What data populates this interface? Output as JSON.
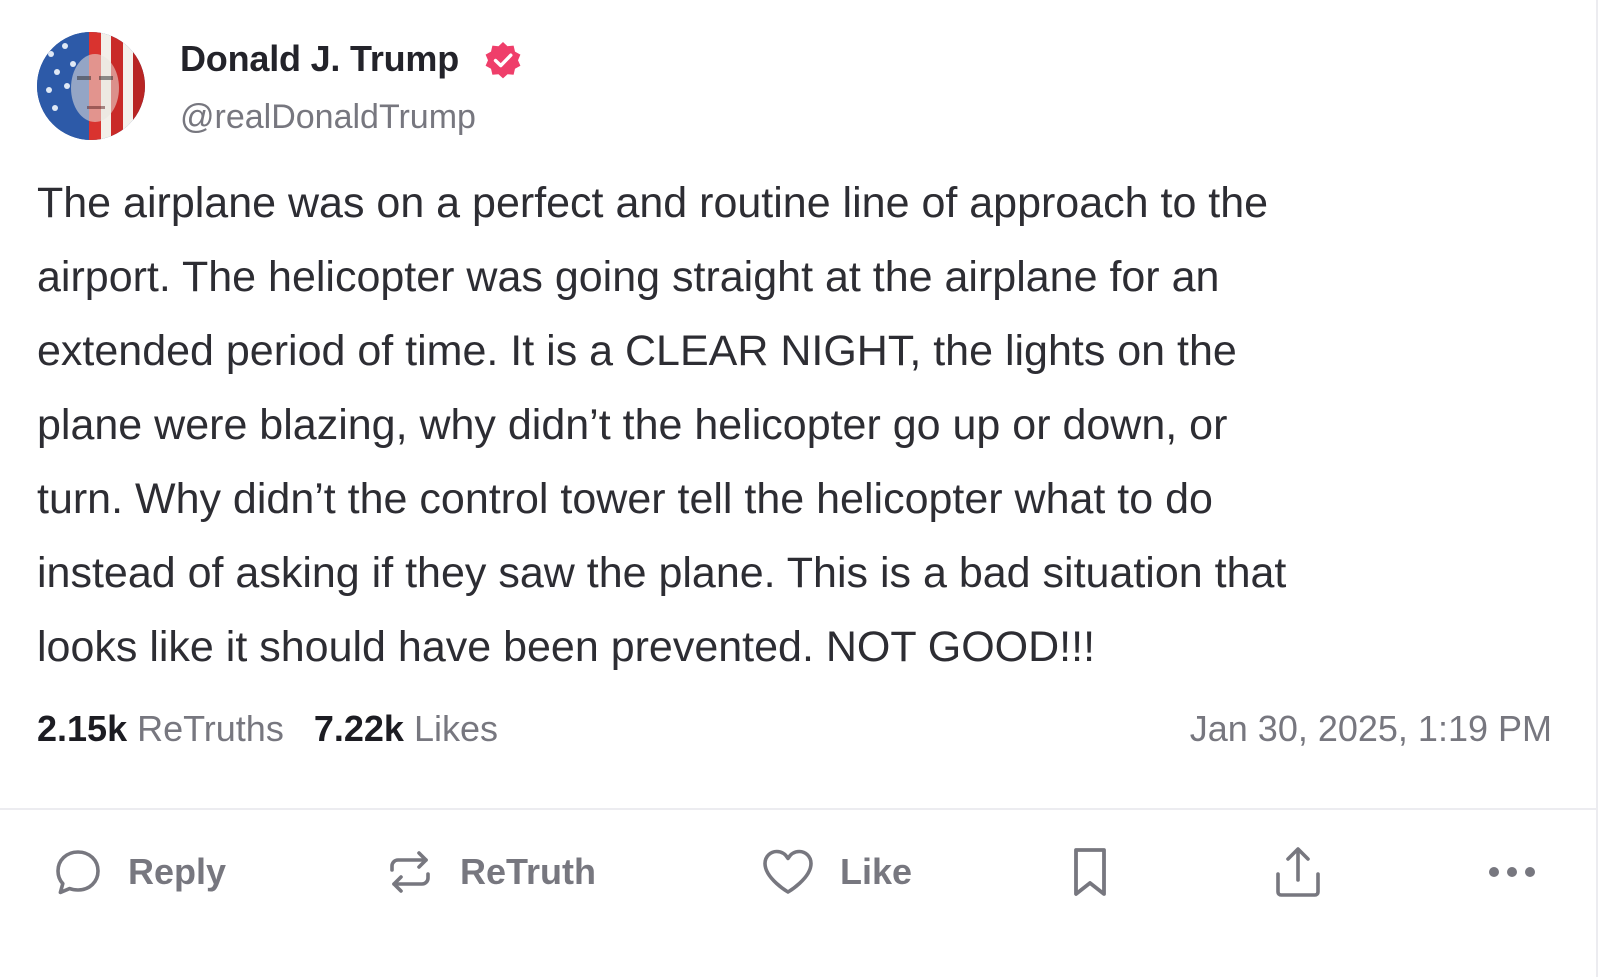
{
  "author": {
    "display_name": "Donald J. Trump",
    "handle": "@realDonaldTrump",
    "verified": true,
    "verified_badge_color": "#ef3e6a"
  },
  "post": {
    "lines": [
      "The airplane was on a perfect and routine line of approach to the",
      "airport. The helicopter was going straight at the airplane for an",
      "extended period of time. It is a CLEAR NIGHT, the lights on the",
      "plane were blazing, why didn’t the helicopter go up or down, or",
      "turn. Why didn’t the control tower tell the helicopter what to do",
      "instead of asking if they saw the plane. This is a bad situation that",
      "looks like it should have been prevented. NOT GOOD!!!"
    ]
  },
  "stats": {
    "retruths_count": "2.15k",
    "retruths_label": "ReTruths",
    "likes_count": "7.22k",
    "likes_label": "Likes",
    "timestamp": "Jan 30, 2025, 1:19 PM"
  },
  "actions": {
    "reply_label": "Reply",
    "retruth_label": "ReTruth",
    "like_label": "Like",
    "icons": [
      "reply-icon",
      "retruth-icon",
      "heart-icon",
      "bookmark-icon",
      "share-icon",
      "more-icon"
    ]
  },
  "colors": {
    "text_primary": "#2d2d33",
    "text_muted": "#77777f",
    "divider": "#ececf0"
  }
}
